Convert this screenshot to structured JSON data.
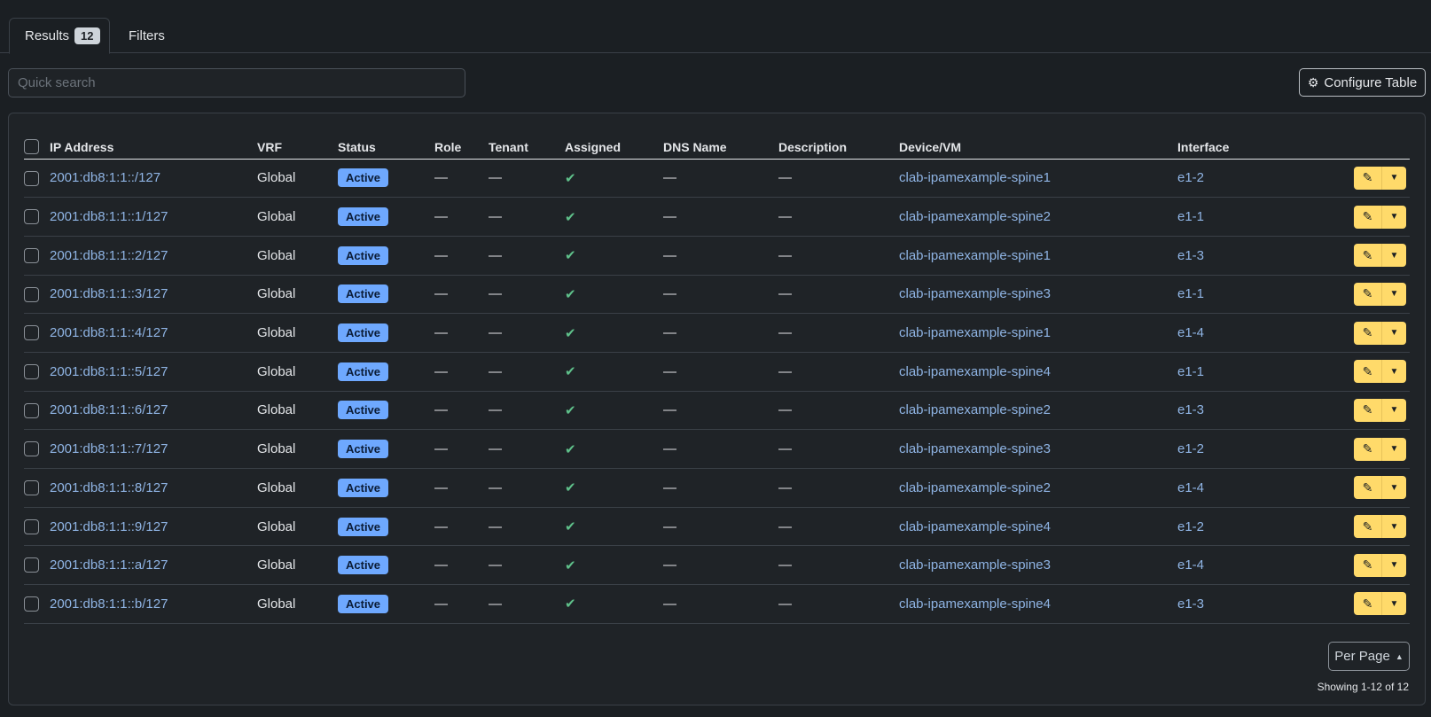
{
  "tabs": {
    "results_label": "Results",
    "results_count": "12",
    "filters_label": "Filters"
  },
  "search": {
    "placeholder": "Quick search"
  },
  "configure_label": "Configure Table",
  "columns": [
    "IP Address",
    "VRF",
    "Status",
    "Role",
    "Tenant",
    "Assigned",
    "DNS Name",
    "Description",
    "Device/VM",
    "Interface"
  ],
  "rows": [
    {
      "ip": "2001:db8:1:1::/127",
      "vrf": "Global",
      "status": "Active",
      "role": "—",
      "tenant": "—",
      "assigned": "✔",
      "dns": "—",
      "desc": "—",
      "device": "clab-ipamexample-spine1",
      "iface": "e1-2"
    },
    {
      "ip": "2001:db8:1:1::1/127",
      "vrf": "Global",
      "status": "Active",
      "role": "—",
      "tenant": "—",
      "assigned": "✔",
      "dns": "—",
      "desc": "—",
      "device": "clab-ipamexample-spine2",
      "iface": "e1-1"
    },
    {
      "ip": "2001:db8:1:1::2/127",
      "vrf": "Global",
      "status": "Active",
      "role": "—",
      "tenant": "—",
      "assigned": "✔",
      "dns": "—",
      "desc": "—",
      "device": "clab-ipamexample-spine1",
      "iface": "e1-3"
    },
    {
      "ip": "2001:db8:1:1::3/127",
      "vrf": "Global",
      "status": "Active",
      "role": "—",
      "tenant": "—",
      "assigned": "✔",
      "dns": "—",
      "desc": "—",
      "device": "clab-ipamexample-spine3",
      "iface": "e1-1"
    },
    {
      "ip": "2001:db8:1:1::4/127",
      "vrf": "Global",
      "status": "Active",
      "role": "—",
      "tenant": "—",
      "assigned": "✔",
      "dns": "—",
      "desc": "—",
      "device": "clab-ipamexample-spine1",
      "iface": "e1-4"
    },
    {
      "ip": "2001:db8:1:1::5/127",
      "vrf": "Global",
      "status": "Active",
      "role": "—",
      "tenant": "—",
      "assigned": "✔",
      "dns": "—",
      "desc": "—",
      "device": "clab-ipamexample-spine4",
      "iface": "e1-1"
    },
    {
      "ip": "2001:db8:1:1::6/127",
      "vrf": "Global",
      "status": "Active",
      "role": "—",
      "tenant": "—",
      "assigned": "✔",
      "dns": "—",
      "desc": "—",
      "device": "clab-ipamexample-spine2",
      "iface": "e1-3"
    },
    {
      "ip": "2001:db8:1:1::7/127",
      "vrf": "Global",
      "status": "Active",
      "role": "—",
      "tenant": "—",
      "assigned": "✔",
      "dns": "—",
      "desc": "—",
      "device": "clab-ipamexample-spine3",
      "iface": "e1-2"
    },
    {
      "ip": "2001:db8:1:1::8/127",
      "vrf": "Global",
      "status": "Active",
      "role": "—",
      "tenant": "—",
      "assigned": "✔",
      "dns": "—",
      "desc": "—",
      "device": "clab-ipamexample-spine2",
      "iface": "e1-4"
    },
    {
      "ip": "2001:db8:1:1::9/127",
      "vrf": "Global",
      "status": "Active",
      "role": "—",
      "tenant": "—",
      "assigned": "✔",
      "dns": "—",
      "desc": "—",
      "device": "clab-ipamexample-spine4",
      "iface": "e1-2"
    },
    {
      "ip": "2001:db8:1:1::a/127",
      "vrf": "Global",
      "status": "Active",
      "role": "—",
      "tenant": "—",
      "assigned": "✔",
      "dns": "—",
      "desc": "—",
      "device": "clab-ipamexample-spine3",
      "iface": "e1-4"
    },
    {
      "ip": "2001:db8:1:1::b/127",
      "vrf": "Global",
      "status": "Active",
      "role": "—",
      "tenant": "—",
      "assigned": "✔",
      "dns": "—",
      "desc": "—",
      "device": "clab-ipamexample-spine4",
      "iface": "e1-3"
    }
  ],
  "per_page_label": "Per Page",
  "showing_text": "Showing 1-12 of 12",
  "colors": {
    "background": "#1b1f23",
    "link": "#8fb4e4",
    "status_badge": "#6ea8fe",
    "edit_button": "#ffda6a",
    "check": "#5fc08a"
  },
  "icons": {
    "configure": "gear-icon",
    "edit": "pencil-icon",
    "dropdown": "caret-down-icon",
    "per_page": "caret-up-icon",
    "assigned": "check-icon"
  }
}
